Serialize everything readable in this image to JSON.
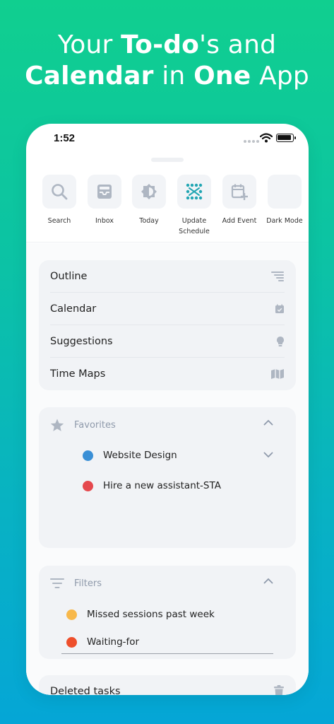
{
  "headline": {
    "line1_pre": "Your ",
    "line1_bold": "To-do",
    "line1_post": "'s and",
    "line2_bold1": "Calendar",
    "line2_mid": " in ",
    "line2_bold2": "One",
    "line2_post": " App"
  },
  "status_bar": {
    "time": "1:52"
  },
  "quick_actions": [
    {
      "label": "Search",
      "icon": "search-icon"
    },
    {
      "label": "Inbox",
      "icon": "inbox-icon"
    },
    {
      "label": "Today",
      "icon": "today-icon"
    },
    {
      "label": "Update\nSchedule",
      "icon": "update-schedule-icon"
    },
    {
      "label": "Add Event",
      "icon": "add-event-icon"
    },
    {
      "label": "Dark Mode",
      "icon": "moon-icon"
    }
  ],
  "nav": [
    {
      "label": "Outline",
      "icon": "outline-icon"
    },
    {
      "label": "Calendar",
      "icon": "calendar-check-icon"
    },
    {
      "label": "Suggestions",
      "icon": "lightbulb-icon"
    },
    {
      "label": "Time Maps",
      "icon": "map-icon"
    }
  ],
  "favorites": {
    "title": "Favorites",
    "items": [
      {
        "label": "Website Design",
        "color": "#3a8fd6",
        "expandable": true
      },
      {
        "label": "Hire a new assistant-STA",
        "color": "#e5484d"
      }
    ]
  },
  "filters": {
    "title": "Filters",
    "items": [
      {
        "label": "Missed sessions past week",
        "color": "#f7b84b"
      },
      {
        "label": "Waiting-for",
        "color": "#ee4f2b"
      }
    ]
  },
  "deleted": {
    "label": "Deleted tasks",
    "icon": "trash-icon"
  },
  "colors": {
    "accent": "#22a6b3",
    "icon_gray": "#aeb6c2"
  }
}
